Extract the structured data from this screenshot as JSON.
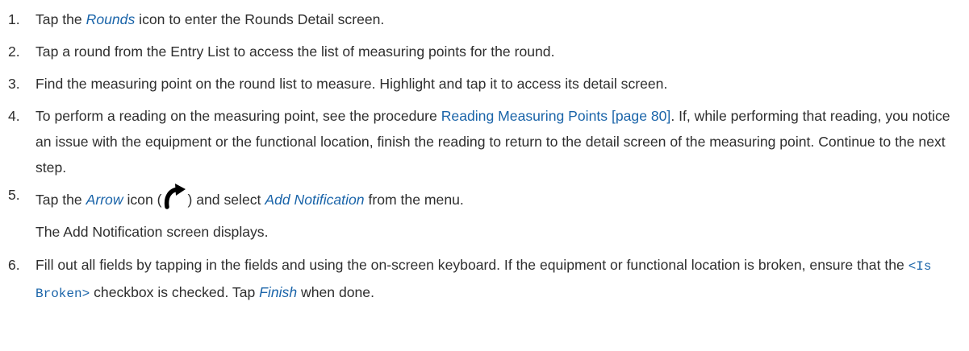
{
  "steps": [
    {
      "num": "1.",
      "a": "Tap the ",
      "em": "Rounds",
      "b": " icon to enter the Rounds Detail screen."
    },
    {
      "num": "2.",
      "text": "Tap a round from the Entry List to access the list of measuring points for the round."
    },
    {
      "num": "3.",
      "text": "Find the measuring point on the round list to measure. Highlight and tap it to access its detail screen."
    },
    {
      "num": "4.",
      "a": "To perform a reading on the measuring point, see the procedure ",
      "link": "Reading Measuring Points [page 80]",
      "b": ". If, while performing that reading, you notice an issue with the equipment or the functional location, finish the reading to return to the detail screen of the measuring point. Continue to the next step."
    },
    {
      "num": "5.",
      "a": "Tap the ",
      "em1": "Arrow",
      "b": " icon (",
      "icon": "curved-arrow-icon",
      "c": ") and select ",
      "em2": "Add Notification",
      "d": " from the menu.",
      "result": "The Add Notification screen displays."
    },
    {
      "num": "6.",
      "a": "Fill out all fields by tapping in the fields and using the on-screen keyboard. If the equipment or functional location is broken, ensure that the ",
      "code": "<Is Broken>",
      "b": " checkbox is checked. Tap ",
      "em": "Finish",
      "c": " when done."
    }
  ]
}
